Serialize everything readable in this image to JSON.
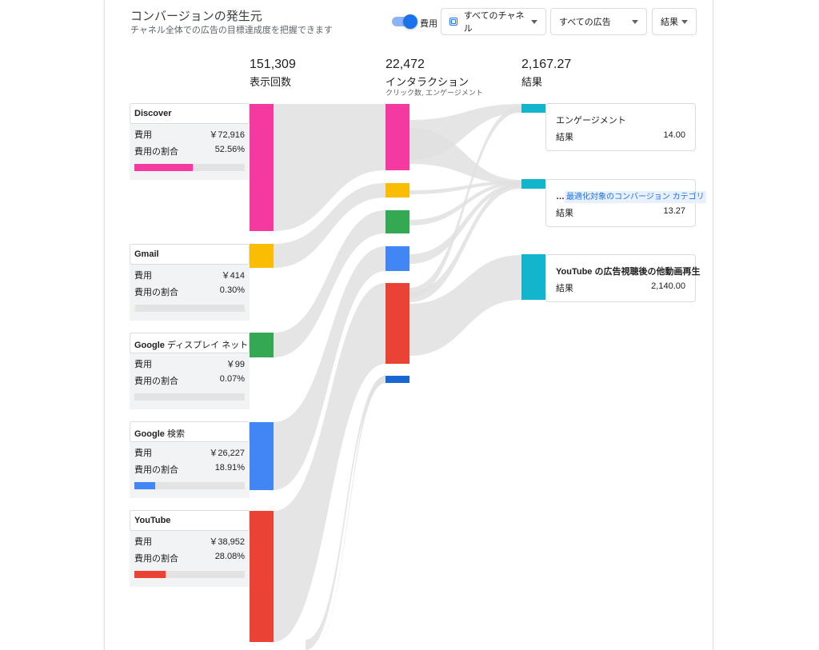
{
  "header": {
    "title": "コンバージョンの発生元",
    "subtitle": "チャネル全体での広告の目標達成度を把握できます",
    "cost_toggle_label": "費用",
    "channel_dropdown": "すべてのチャネル",
    "ads_dropdown": "すべての広告",
    "metric_dropdown": "結果"
  },
  "stages": [
    {
      "value": "151,309",
      "label": "表示回数",
      "sub": ""
    },
    {
      "value": "22,472",
      "label": "インタラクション",
      "sub": "クリック数, エンゲージメント"
    },
    {
      "value": "2,167.27",
      "label": "結果",
      "sub": ""
    }
  ],
  "sources": [
    {
      "name": "Discover",
      "suffix": "",
      "cost_label": "費用",
      "cost": "￥72,916",
      "share_label": "費用の割合",
      "share": "52.56%",
      "share_value": 52.56,
      "color": "#f439a0"
    },
    {
      "name": "Gmail",
      "suffix": "",
      "cost_label": "費用",
      "cost": "￥414",
      "share_label": "費用の割合",
      "share": "0.30%",
      "share_value": 0.3,
      "color": "#fbbc04"
    },
    {
      "name": "Google",
      "suffix": " ディスプレイ ネット…",
      "cost_label": "費用",
      "cost": "￥99",
      "share_label": "費用の割合",
      "share": "0.07%",
      "share_value": 0.07,
      "color": "#34a853"
    },
    {
      "name": "Google",
      "suffix": " 検索",
      "cost_label": "費用",
      "cost": "￥26,227",
      "share_label": "費用の割合",
      "share": "18.91%",
      "share_value": 18.91,
      "color": "#4285f4"
    },
    {
      "name": "YouTube",
      "suffix": "",
      "cost_label": "費用",
      "cost": "￥38,952",
      "share_label": "費用の割合",
      "share": "28.08%",
      "share_value": 28.08,
      "color": "#ea4335"
    }
  ],
  "results": [
    {
      "prefix": "",
      "name": "エンゲージメント",
      "bold": false,
      "link": false,
      "value_label": "結果",
      "value": "14.00"
    },
    {
      "prefix": "…",
      "name": "最適化対象のコンバージョン カテゴリ",
      "bold": false,
      "link": true,
      "value_label": "結果",
      "value": "13.27"
    },
    {
      "prefix": "",
      "name": "YouTube の広告視聴後の他動画再生",
      "bold": true,
      "link": false,
      "value_label": "結果",
      "value": "2,140.00"
    }
  ],
  "colors": {
    "result_bar": "#12b5cb",
    "extra_interaction": "#1967d2",
    "flow": "#e0e0e0"
  }
}
